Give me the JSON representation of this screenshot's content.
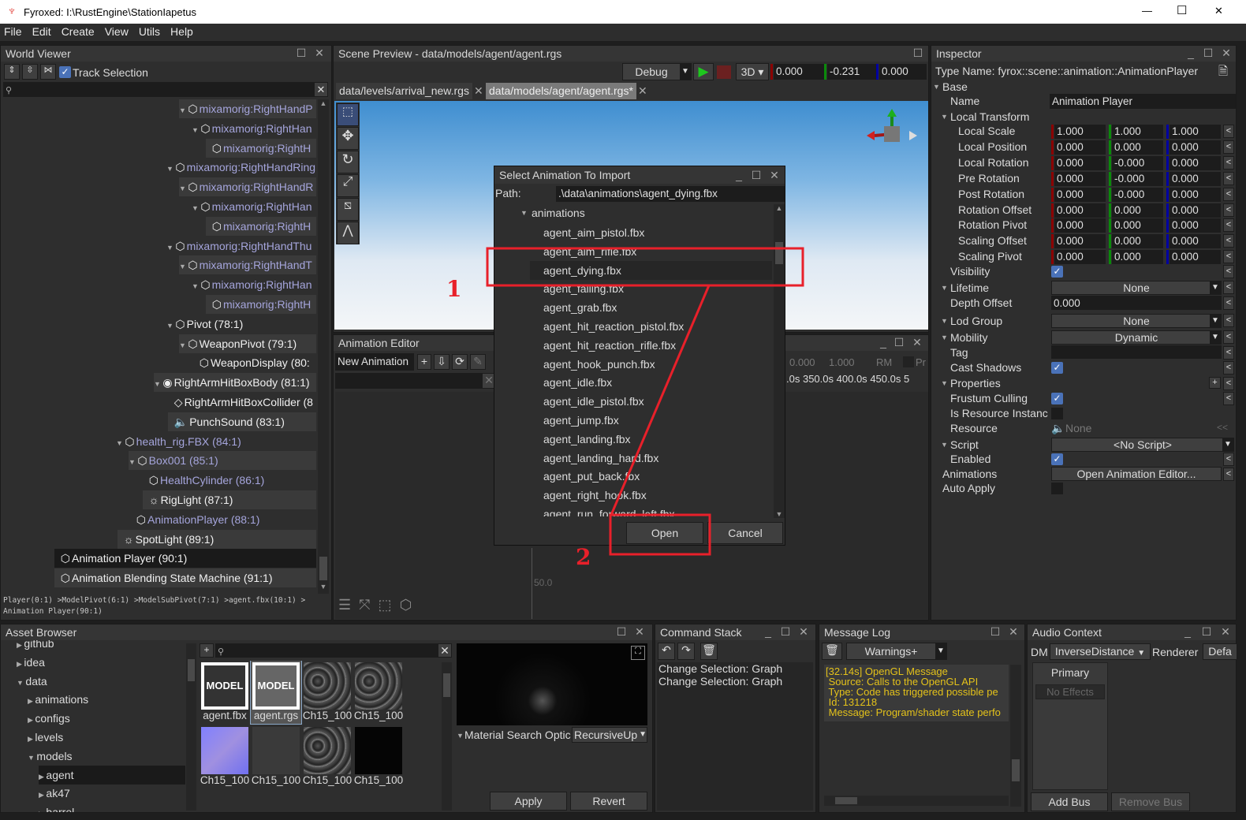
{
  "window": {
    "title": "Fyroxed: I:\\RustEngine\\StationIapetus",
    "minimize": "—",
    "maximize": "☐",
    "close": "✕"
  },
  "menu": [
    "File",
    "Edit",
    "Create",
    "View",
    "Utils",
    "Help"
  ],
  "world_viewer": {
    "title": "World Viewer",
    "track_selection": "Track Selection",
    "items": [
      {
        "label": "mixamorig:RightHandP",
        "depth": 10,
        "expand": true,
        "color": "purple",
        "icon": "cube"
      },
      {
        "label": "mixamorig:RightHan",
        "depth": 11,
        "expand": true,
        "color": "purple",
        "icon": "cube"
      },
      {
        "label": "mixamorig:RightH",
        "depth": 12,
        "expand": false,
        "color": "purple",
        "icon": "cube"
      },
      {
        "label": "mixamorig:RightHandRing",
        "depth": 9,
        "expand": true,
        "color": "purple",
        "icon": "cube"
      },
      {
        "label": "mixamorig:RightHandR",
        "depth": 10,
        "expand": true,
        "color": "purple",
        "icon": "cube"
      },
      {
        "label": "mixamorig:RightHan",
        "depth": 11,
        "expand": true,
        "color": "purple",
        "icon": "cube"
      },
      {
        "label": "mixamorig:RightH",
        "depth": 12,
        "expand": false,
        "color": "purple",
        "icon": "cube"
      },
      {
        "label": "mixamorig:RightHandThu",
        "depth": 9,
        "expand": true,
        "color": "purple",
        "icon": "cube"
      },
      {
        "label": "mixamorig:RightHandT",
        "depth": 10,
        "expand": true,
        "color": "purple",
        "icon": "cube"
      },
      {
        "label": "mixamorig:RightHan",
        "depth": 11,
        "expand": true,
        "color": "purple",
        "icon": "cube"
      },
      {
        "label": "mixamorig:RightH",
        "depth": 12,
        "expand": false,
        "color": "purple",
        "icon": "cube"
      },
      {
        "label": "Pivot (78:1)",
        "depth": 9,
        "expand": true,
        "color": "white",
        "icon": "cube"
      },
      {
        "label": "WeaponPivot (79:1)",
        "depth": 10,
        "expand": true,
        "color": "white",
        "icon": "cube"
      },
      {
        "label": "WeaponDisplay (80:",
        "depth": 11,
        "expand": false,
        "color": "white",
        "icon": "cube"
      },
      {
        "label": "RightArmHitBoxBody (81:1)",
        "depth": 8,
        "expand": true,
        "color": "white",
        "icon": "rigid-body"
      },
      {
        "label": "RightArmHitBoxCollider (8",
        "depth": 9,
        "expand": false,
        "color": "white",
        "icon": "collider"
      },
      {
        "label": "PunchSound (83:1)",
        "depth": 9,
        "expand": false,
        "color": "white",
        "icon": "sound"
      },
      {
        "label": "health_rig.FBX (84:1)",
        "depth": 5,
        "expand": true,
        "color": "purple",
        "icon": "cube"
      },
      {
        "label": "Box001 (85:1)",
        "depth": 6,
        "expand": true,
        "color": "purple",
        "icon": "cube"
      },
      {
        "label": "HealthCylinder (86:1)",
        "depth": 7,
        "expand": false,
        "color": "purple",
        "icon": "cube"
      },
      {
        "label": "RigLight (87:1)",
        "depth": 7,
        "expand": false,
        "color": "white",
        "icon": "light"
      },
      {
        "label": "AnimationPlayer (88:1)",
        "depth": 6,
        "expand": false,
        "color": "purple",
        "icon": "cube"
      },
      {
        "label": "SpotLight (89:1)",
        "depth": 5,
        "expand": false,
        "color": "white",
        "icon": "light"
      },
      {
        "label": "Animation Player (90:1)",
        "depth": 0,
        "expand": false,
        "color": "white",
        "icon": "cube",
        "selected": true
      },
      {
        "label": "Animation Blending State Machine (91:1)",
        "depth": 0,
        "expand": false,
        "color": "white",
        "icon": "cube"
      }
    ],
    "breadcrumb": "Player(0:1) >ModelPivot(6:1) >ModelSubPivot(7:1) >agent.fbx(10:1) > Animation Player(90:1)"
  },
  "scene_preview": {
    "title": "Scene Preview - data/models/agent/agent.rgs",
    "mode": "Debug",
    "projection": "3D",
    "x": "0.000",
    "y": "-0.231",
    "z": "0.000",
    "tabs": [
      "data/levels/arrival_new.rgs",
      "data/models/agent/agent.rgs*"
    ]
  },
  "animation_editor": {
    "title": "Animation Editor",
    "selected": "New Animation",
    "speed": "0.000",
    "length": "1.000",
    "rm": "RM",
    "pr": "Pr",
    "ruler": [
      ".0s",
      "350.0s",
      "400.0s",
      "450.0s",
      "5"
    ],
    "timeline_label": "50.0"
  },
  "dialog": {
    "title": "Select Animation To Import",
    "path_label": "Path:",
    "path": ".\\data\\animations\\agent_dying.fbx",
    "folder": "animations",
    "files": [
      "agent_aim_pistol.fbx",
      "agent_aim_rifle.fbx",
      "agent_dying.fbx",
      "agent_falling.fbx",
      "agent_grab.fbx",
      "agent_hit_reaction_pistol.fbx",
      "agent_hit_reaction_rifle.fbx",
      "agent_hook_punch.fbx",
      "agent_idle.fbx",
      "agent_idle_pistol.fbx",
      "agent_jump.fbx",
      "agent_landing.fbx",
      "agent_landing_hard.fbx",
      "agent_put_back.fbx",
      "agent_right_hook.fbx",
      "agent_run_forward_left.fbx"
    ],
    "selected_index": 2,
    "open": "Open",
    "cancel": "Cancel"
  },
  "annotations": {
    "step1": "1",
    "step2": "2",
    "color": "#e8202a"
  },
  "inspector": {
    "title": "Inspector",
    "type_name": "Type Name: fyrox::scene::animation::AnimationPlayer",
    "base": "Base",
    "name_label": "Name",
    "name_value": "Animation Player",
    "local_transform": "Local Transform",
    "vectors": [
      {
        "label": "Local Scale",
        "v": [
          "1.000",
          "1.000",
          "1.000"
        ]
      },
      {
        "label": "Local Position",
        "v": [
          "0.000",
          "0.000",
          "0.000"
        ]
      },
      {
        "label": "Local Rotation",
        "v": [
          "0.000",
          "-0.000",
          "0.000"
        ]
      },
      {
        "label": "Pre Rotation",
        "v": [
          "0.000",
          "-0.000",
          "0.000"
        ]
      },
      {
        "label": "Post Rotation",
        "v": [
          "0.000",
          "-0.000",
          "0.000"
        ]
      },
      {
        "label": "Rotation Offset",
        "v": [
          "0.000",
          "0.000",
          "0.000"
        ]
      },
      {
        "label": "Rotation Pivot",
        "v": [
          "0.000",
          "0.000",
          "0.000"
        ]
      },
      {
        "label": "Scaling Offset",
        "v": [
          "0.000",
          "0.000",
          "0.000"
        ]
      },
      {
        "label": "Scaling Pivot",
        "v": [
          "0.000",
          "0.000",
          "0.000"
        ]
      }
    ],
    "visibility": "Visibility",
    "lifetime": "Lifetime",
    "lifetime_value": "None",
    "depth_offset": "Depth Offset",
    "depth_offset_value": "0.000",
    "lod_group": "Lod Group",
    "lod_value": "None",
    "mobility": "Mobility",
    "mobility_value": "Dynamic",
    "tag": "Tag",
    "cast_shadows": "Cast Shadows",
    "properties": "Properties",
    "frustum_culling": "Frustum Culling",
    "is_resource_instance": "Is Resource Instanc",
    "resource": "Resource",
    "resource_value": "None",
    "script": "Script",
    "script_value": "<No Script>",
    "enabled": "Enabled",
    "animations": "Animations",
    "open_editor": "Open Animation Editor...",
    "auto_apply": "Auto Apply"
  },
  "asset_browser": {
    "title": "Asset Browser",
    "folders": [
      {
        "label": "github",
        "depth": 0,
        "open": false
      },
      {
        "label": "idea",
        "depth": 0,
        "open": false
      },
      {
        "label": "data",
        "depth": 0,
        "open": true
      },
      {
        "label": "animations",
        "depth": 1,
        "open": false
      },
      {
        "label": "configs",
        "depth": 1,
        "open": false
      },
      {
        "label": "levels",
        "depth": 1,
        "open": false
      },
      {
        "label": "models",
        "depth": 1,
        "open": true
      },
      {
        "label": "agent",
        "depth": 2,
        "open": false,
        "selected": true
      },
      {
        "label": "ak47",
        "depth": 2,
        "open": false
      },
      {
        "label": "barrel",
        "depth": 2,
        "open": false
      }
    ],
    "assets": [
      {
        "label": "agent.fbx",
        "kind": "model"
      },
      {
        "label": "agent.rgs",
        "kind": "model",
        "selected": true
      },
      {
        "label": "Ch15_100",
        "kind": "tex"
      },
      {
        "label": "Ch15_100",
        "kind": "tex"
      },
      {
        "label": "Ch15_100",
        "kind": "normal"
      },
      {
        "label": "Ch15_100",
        "kind": "dark"
      },
      {
        "label": "Ch15_100",
        "kind": "tex"
      },
      {
        "label": "Ch15_100",
        "kind": "black"
      }
    ],
    "model_badge": "MODEL",
    "material_search": "Material Search Optic",
    "material_search_value": "RecursiveUp",
    "apply": "Apply",
    "revert": "Revert"
  },
  "command_stack": {
    "title": "Command Stack",
    "items": [
      "Change Selection: Graph",
      "Change Selection: Graph"
    ]
  },
  "message_log": {
    "title": "Message Log",
    "filter": "Warnings+",
    "lines": [
      "[32.14s] OpenGL Message",
      " Source: Calls to the OpenGL API",
      " Type: Code has triggered possible pe",
      " Id: 131218",
      " Message: Program/shader state perfo"
    ]
  },
  "audio_context": {
    "title": "Audio Context",
    "dm_label": "DM",
    "dm_value": "InverseDistance",
    "renderer_label": "Renderer",
    "renderer_value": "Defa",
    "bus": "Primary",
    "no_effects": "No Effects",
    "add_bus": "Add Bus",
    "remove_bus": "Remove Bus"
  }
}
